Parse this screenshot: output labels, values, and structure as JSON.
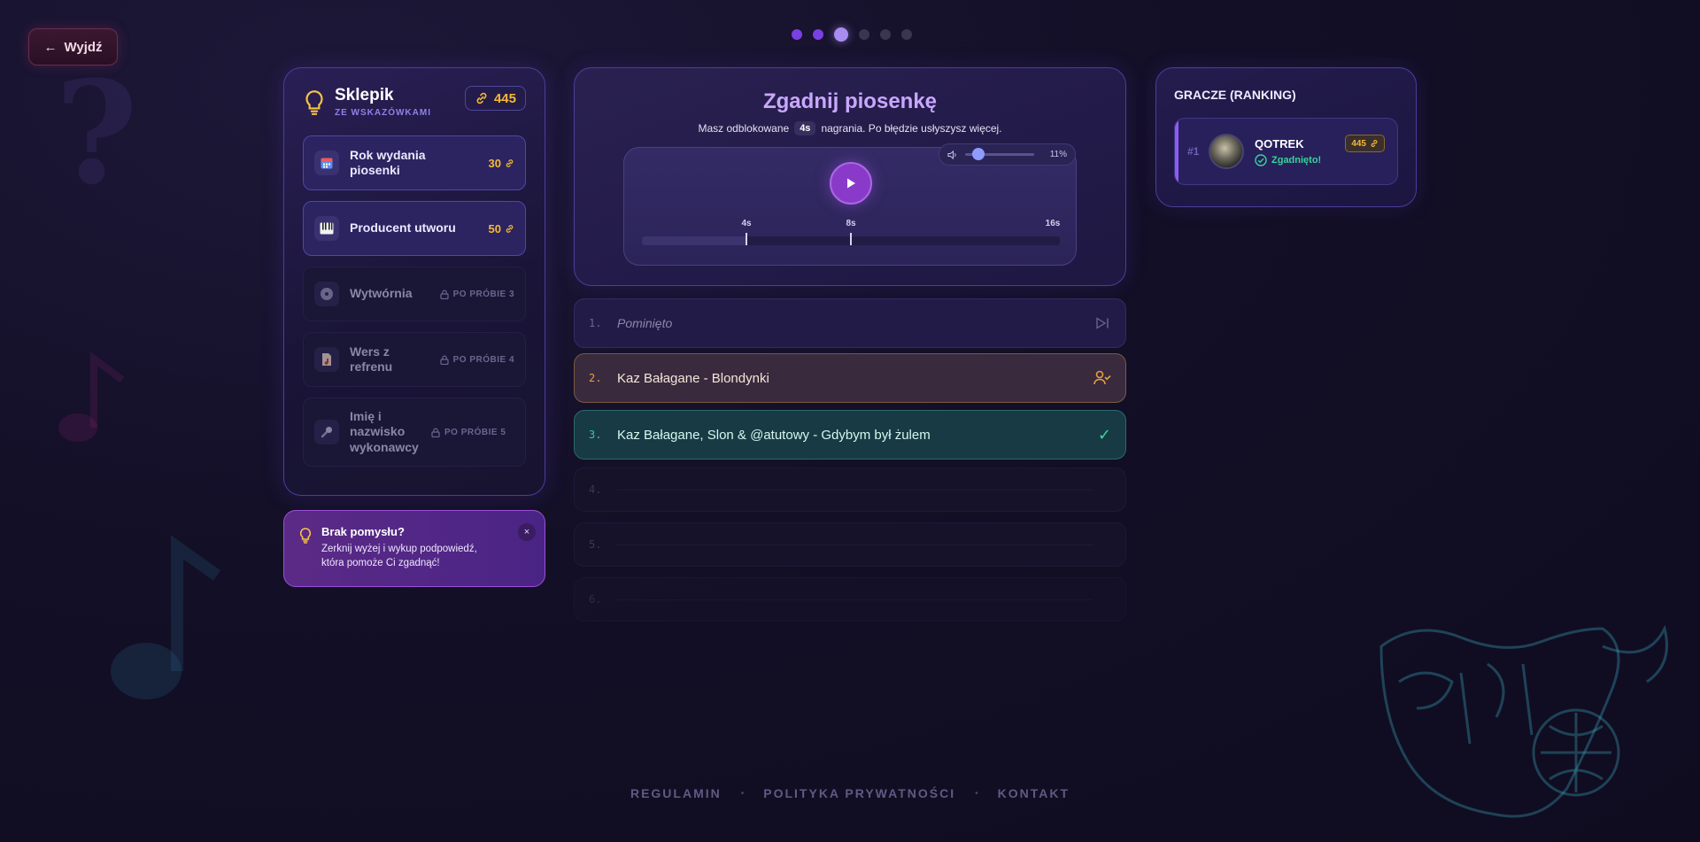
{
  "header": {
    "exit_label": "Wyjdź",
    "progress": {
      "total": 6,
      "completed": 2,
      "current": 3
    }
  },
  "shop": {
    "title": "Sklepik",
    "subtitle": "ZE WSKAZÓWKAMI",
    "coins": "445",
    "items": [
      {
        "label": "Rok wydania piosenki",
        "price": "30",
        "icon": "calendar-icon",
        "state": "available"
      },
      {
        "label": "Producent utworu",
        "price": "50",
        "icon": "piano-icon",
        "state": "available"
      },
      {
        "label": "Wytwórnia",
        "lock": "PO PRÓBIE 3",
        "icon": "vinyl-icon",
        "state": "locked"
      },
      {
        "label": "Wers z refrenu",
        "lock": "PO PRÓBIE 4",
        "icon": "note-icon",
        "state": "locked"
      },
      {
        "label": "Imię i nazwisko wykonawcy",
        "lock": "PO PRÓBIE 5",
        "icon": "microphone-icon",
        "state": "locked"
      }
    ]
  },
  "hint": {
    "title": "Brak pomysłu?",
    "text": "Zerknij wyżej i wykup podpowiedź, która pomoże Ci zgadnąć!",
    "close": "×"
  },
  "game": {
    "title": "Zgadnij piosenkę",
    "sub_before": "Masz odblokowane",
    "unlocked": "4s",
    "sub_after": "nagrania. Po błędzie usłyszysz więcej.",
    "volume": "11%",
    "volume_fraction": 0.11,
    "timeline": {
      "max_seconds": 16,
      "unlocked_seconds": 4,
      "markers": [
        {
          "label": "4s",
          "seconds": 4
        },
        {
          "label": "8s",
          "seconds": 8
        },
        {
          "label": "16s",
          "seconds": 16
        }
      ]
    }
  },
  "guesses": [
    {
      "num": "1.",
      "text": "Pominięto",
      "state": "skipped"
    },
    {
      "num": "2.",
      "text": "Kaz Bałagane - Blondynki",
      "state": "partial"
    },
    {
      "num": "3.",
      "text": "Kaz Bałagane, Slon & @atutowy - Gdybym był żulem",
      "state": "correct",
      "mark": "✓"
    },
    {
      "num": "4.",
      "text": "",
      "state": "empty"
    },
    {
      "num": "5.",
      "text": "",
      "state": "empty"
    },
    {
      "num": "6.",
      "text": "",
      "state": "empty"
    }
  ],
  "ranking": {
    "title": "GRACZE (RANKING)",
    "players": [
      {
        "pos": "#1",
        "name": "QOTREK",
        "status": "Zgadnięto!",
        "score": "445"
      }
    ]
  },
  "footer": {
    "links": [
      "REGULAMIN",
      "POLITYKA PRYWATNOŚCI",
      "KONTAKT"
    ],
    "separator": "•"
  },
  "colors": {
    "accent": "#8a3ac8",
    "coin": "#f6b836",
    "success": "#39d39a",
    "partial_border": "#7a5a42"
  }
}
